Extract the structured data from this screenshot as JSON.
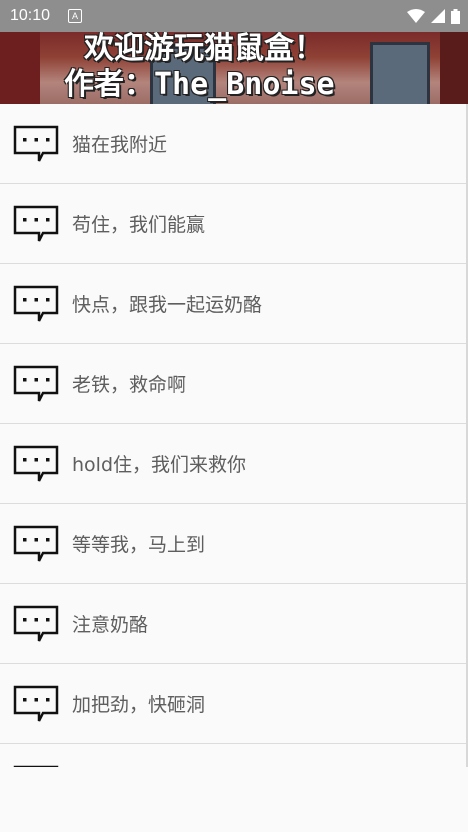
{
  "status_bar": {
    "time": "10:10",
    "notification_icon": "a-icon",
    "icons": [
      "wifi-icon",
      "signal-icon",
      "battery-icon"
    ]
  },
  "banner": {
    "title": "欢迎游玩猫鼠盒！",
    "author": "作者：The_Bnoise"
  },
  "messages": [
    {
      "label": "猫在我附近",
      "icon": "chat-bubble-icon"
    },
    {
      "label": "苟住，我们能赢",
      "icon": "chat-bubble-icon"
    },
    {
      "label": "快点，跟我一起运奶酪",
      "icon": "chat-bubble-icon"
    },
    {
      "label": "老铁，救命啊",
      "icon": "chat-bubble-icon"
    },
    {
      "label": "hold住，我们来救你",
      "icon": "chat-bubble-icon"
    },
    {
      "label": "等等我，马上到",
      "icon": "chat-bubble-icon"
    },
    {
      "label": "注意奶酪",
      "icon": "chat-bubble-icon"
    },
    {
      "label": "加把劲，快砸洞",
      "icon": "chat-bubble-icon"
    },
    {
      "label": "",
      "icon": "chat-bubble-icon"
    }
  ]
}
